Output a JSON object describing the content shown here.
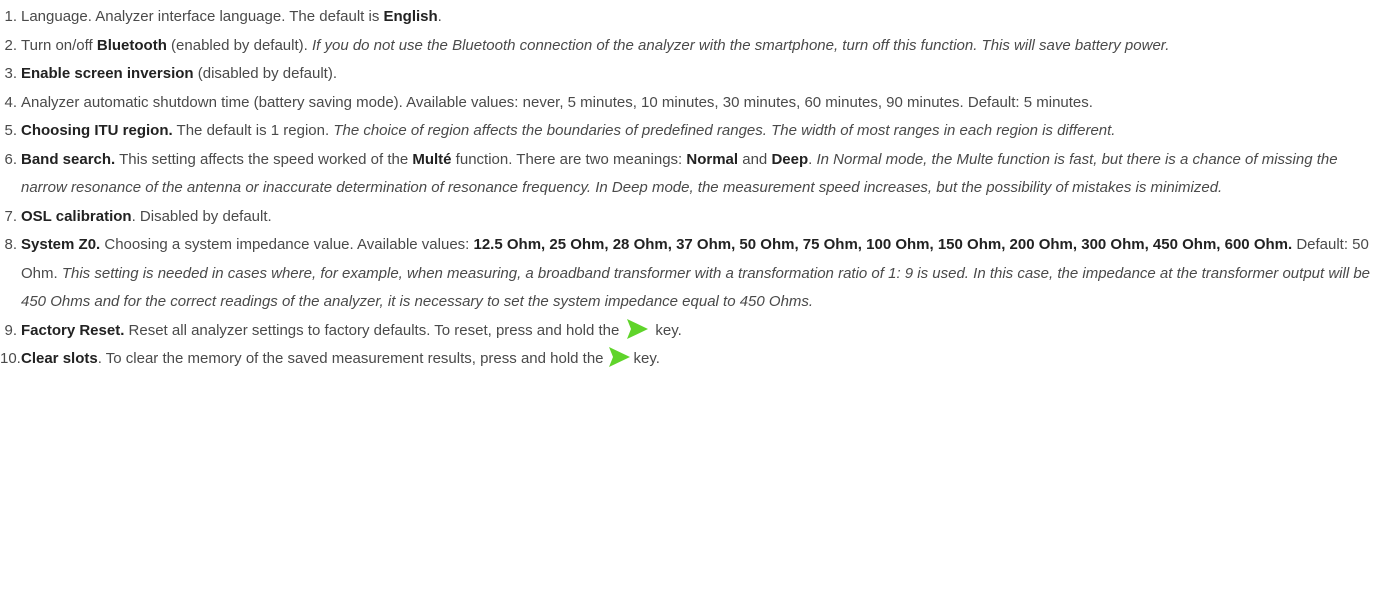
{
  "items": [
    {
      "num": "1.",
      "t1": "Language. Analyzer interface language. The default is ",
      "b1": "English",
      "t2": "."
    },
    {
      "num": "2.",
      "t1": "Turn on/off ",
      "b1": "Bluetooth",
      "t2": " (enabled by default). ",
      "i1": "If you do not use the Bluetooth connection of the analyzer with the smartphone, turn off this function. This will save battery power."
    },
    {
      "num": "3.",
      "b1": "Enable screen inversion",
      "t1": " (disabled by default)."
    },
    {
      "num": "4.",
      "t1": "Analyzer automatic shutdown time (battery saving mode). Available values: never, 5 minutes, 10 minutes, 30 minutes, 60 minutes, 90 minutes. Default: 5 minutes."
    },
    {
      "num": "5.",
      "b1": "Choosing ITU region.",
      "t1": " The default is 1 region. ",
      "i1": "The choice of region affects the boundaries of predefined ranges. The width of most ranges in each region is different."
    },
    {
      "num": "6.",
      "b1": "Band search.",
      "t1": " This setting affects the speed worked of the ",
      "b2": "Multé",
      "t2": " function. There are two meanings: ",
      "b3": "Normal",
      "t3": " and ",
      "b4": "Deep",
      "t4": ". ",
      "i1": "In Normal mode, the Multe function is fast, but there is a chance of missing the narrow resonance of the antenna or inaccurate determination of resonance frequency. In Deep mode, the measurement speed increases, but the possibility of mistakes is minimized."
    },
    {
      "num": "7.",
      "b1": "OSL calibration",
      "t1": ". Disabled by default."
    },
    {
      "num": "8.",
      "b1": "System Z0.",
      "t1": " Choosing a system impedance value. Available values: ",
      "b2": "12.5 Ohm, 25 Ohm, 28 Ohm, 37 Ohm, 50 Ohm, 75 Ohm, 100 Ohm, 150 Ohm, 200 Ohm, 300 Ohm, 450 Ohm, 600 Ohm.",
      "t2": "  Default: 50 Ohm. ",
      "i1": "This setting is needed in cases where, for example, when measuring, a broadband transformer with a transformation ratio of 1: 9 is used. In this case, the impedance at the transformer output will be 450 Ohms and for the correct readings of the analyzer, it is necessary to set the system impedance equal to 450 Ohms."
    },
    {
      "num": "9.",
      "b1": "Factory Reset.",
      "t1": " Reset all analyzer settings to factory defaults. To reset, press and hold the",
      "t2": "key."
    },
    {
      "num": "10.",
      "b1": "Clear slots",
      "t1": ". To clear the memory of the saved measurement results, press and hold the",
      "t2": "key."
    }
  ],
  "icons": {
    "play": "green-play-triangle",
    "play_color": "#5fd42a"
  }
}
